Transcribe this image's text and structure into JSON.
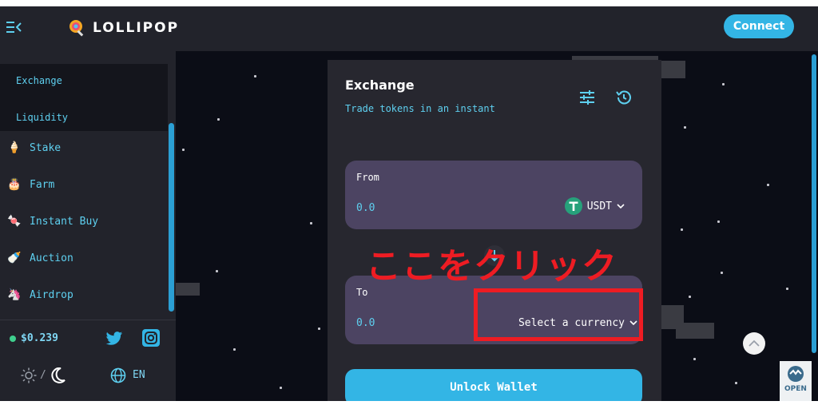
{
  "header": {
    "logo_text": "LOLLIPOP",
    "connect_label": "Connect"
  },
  "sidebar": {
    "sub_items": [
      {
        "label": "Exchange"
      },
      {
        "label": "Liquidity"
      }
    ],
    "items": [
      {
        "label": "Stake",
        "icon": "ice-cream-icon",
        "emoji": "🍦"
      },
      {
        "label": "Farm",
        "icon": "cake-icon",
        "emoji": "🎂"
      },
      {
        "label": "Instant Buy",
        "icon": "candy-icon",
        "emoji": "🍬"
      },
      {
        "label": "Auction",
        "icon": "milk-bottle-icon",
        "emoji": "🍼"
      },
      {
        "label": "Airdrop",
        "icon": "unicorn-icon",
        "emoji": "🦄"
      }
    ],
    "price": "$0.239",
    "theme_separator": "/",
    "language": "EN"
  },
  "exchange": {
    "title": "Exchange",
    "subtitle": "Trade tokens in an instant",
    "from": {
      "label": "From",
      "placeholder": "0.0",
      "token": "USDT"
    },
    "to": {
      "label": "To",
      "placeholder": "0.0",
      "select_label": "Select a currency"
    },
    "unlock_label": "Unlock Wallet"
  },
  "annotation": {
    "text": "ここをクリック",
    "color": "#ee1c23"
  },
  "badge": {
    "text": "OPEN"
  },
  "colors": {
    "accent": "#33b5e5",
    "panel": "#4c4462",
    "card": "#27272f",
    "sidebar": "#22232b",
    "background": "#0b0d16",
    "link": "#5ed0f0"
  }
}
